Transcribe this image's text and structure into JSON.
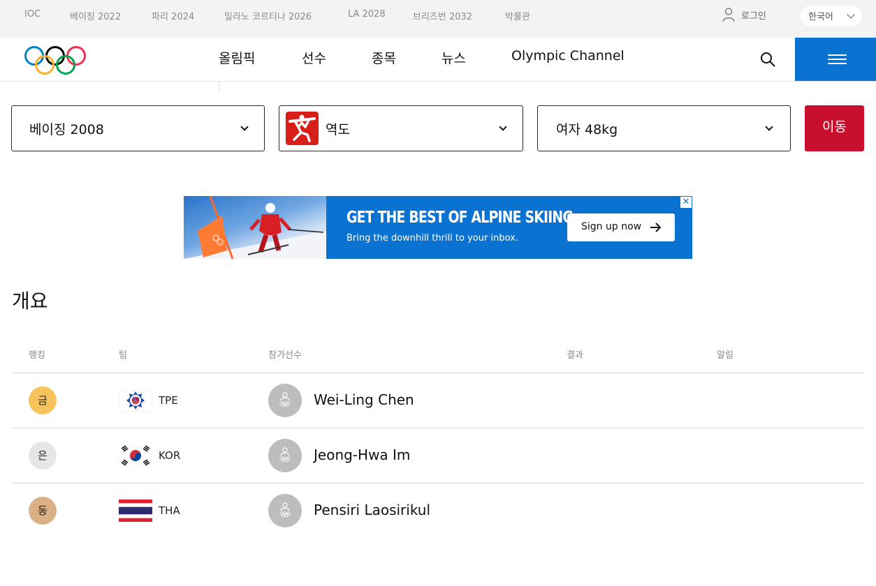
{
  "topbar": {
    "links": [
      "IOC",
      "베이징 2022",
      "파리 2024",
      "밀라노 코르티나 2026",
      "LA 2028",
      "브리즈번 2032",
      "박물관"
    ],
    "login": "로그인",
    "language": "한국어"
  },
  "header": {
    "nav": [
      "올림픽",
      "선수",
      "종목",
      "뉴스",
      "Olympic Channel"
    ],
    "accent_color": "#0a73d1",
    "icons": [
      "olympic-rings-logo",
      "search-icon",
      "hamburger-menu-icon"
    ]
  },
  "filters": {
    "games": "베이징 2008",
    "sport": "역도",
    "event": "여자 48kg",
    "go_label": "이동",
    "go_color": "#c8102e"
  },
  "ad": {
    "headline": "GET THE BEST OF ALPINE SKIING",
    "subtext": "Bring the downhill thrill to your inbox.",
    "button": "Sign up now",
    "close": "✕"
  },
  "overview": {
    "title": "개요",
    "columns": [
      "랭킹",
      "팀",
      "참가선수",
      "결과",
      "알림"
    ],
    "rows": [
      {
        "medal": "금",
        "medal_color": "#f7c35c",
        "noc": "TPE",
        "athlete": "Wei-Ling Chen"
      },
      {
        "medal": "은",
        "medal_color": "#e6e6e6",
        "noc": "KOR",
        "athlete": "Jeong-Hwa Im"
      },
      {
        "medal": "동",
        "medal_color": "#dbb086",
        "noc": "THA",
        "athlete": "Pensiri Laosirikul"
      }
    ]
  }
}
